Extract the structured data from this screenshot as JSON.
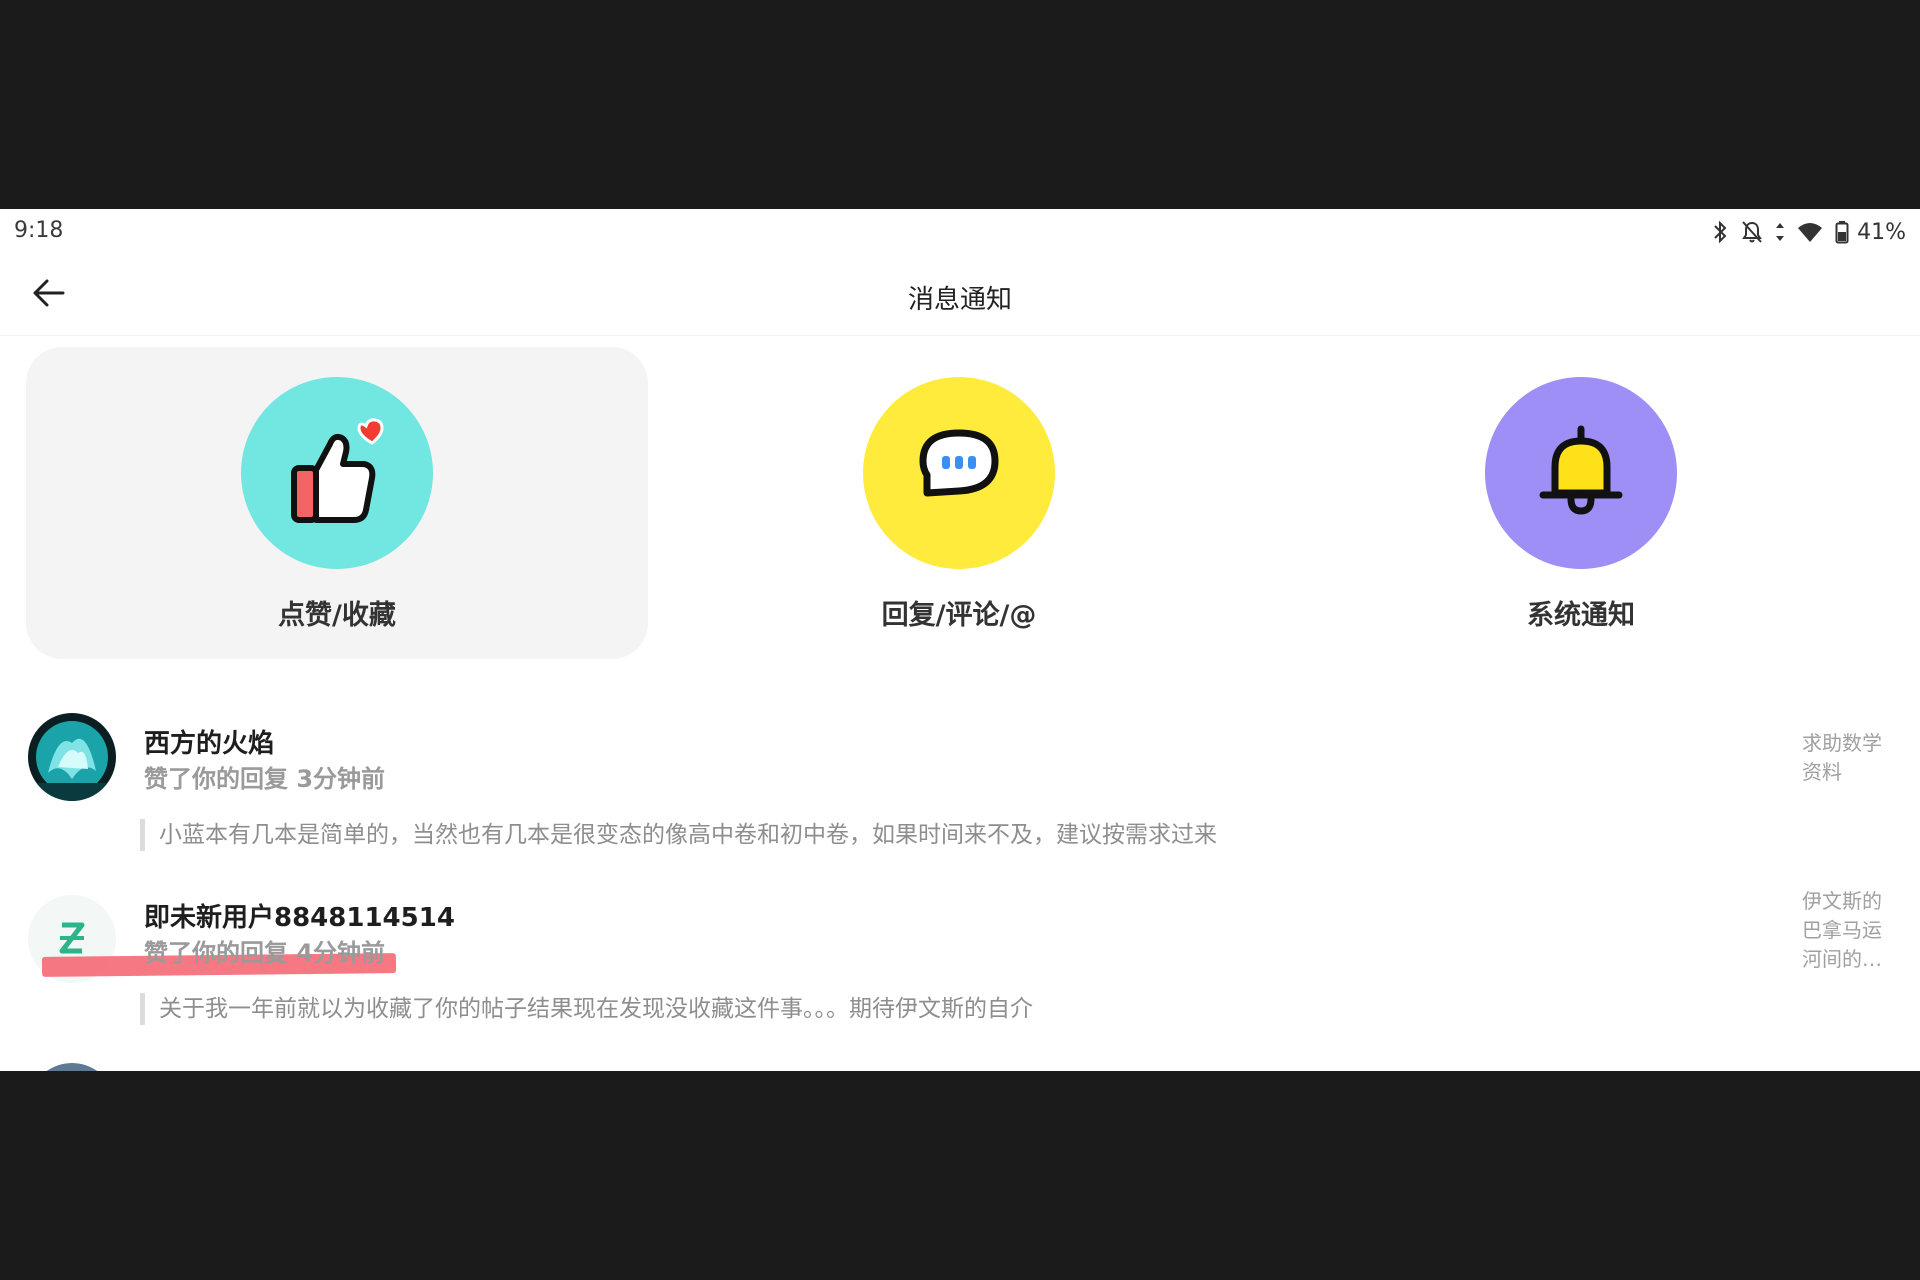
{
  "status_bar": {
    "time": "9:18",
    "icons": [
      "bluetooth-icon",
      "notifications-off-icon",
      "data-arrows-icon",
      "wifi-icon",
      "battery-icon"
    ],
    "battery": "41%"
  },
  "header": {
    "title": "消息通知",
    "back_icon": "arrow-left-icon"
  },
  "tabs": [
    {
      "label": "点赞/收藏",
      "icon": "thumbs-up-heart-icon",
      "color": "#72e6e0",
      "active": true
    },
    {
      "label": "回复/评论/@",
      "icon": "chat-bubble-icon",
      "color": "#ffeb3b",
      "active": false
    },
    {
      "label": "系统通知",
      "icon": "bell-icon",
      "color": "#9d8ff5",
      "active": false
    }
  ],
  "notifications": [
    {
      "user": "西方的火焰",
      "action": "赞了你的回复 3分钟前",
      "quote": "小蓝本有几本是简单的，当然也有几本是很变态的像高中卷和初中卷，如果时间来不及，建议按需求过来",
      "post_title": "求助数学资料"
    },
    {
      "user": "即未新用户8848114514",
      "action": "赞了你的回复 4分钟前",
      "quote": "关于我一年前就以为收藏了你的帖子结果现在发现没收藏这件事。。。期待伊文斯的自介",
      "post_title": "伊文斯的巴拿马运河间的…"
    }
  ],
  "colors": {
    "highlight_mark": "#f4606c",
    "avatar_teal": "#1aa3a8",
    "avatar_logo_green": "#2bb58a"
  }
}
